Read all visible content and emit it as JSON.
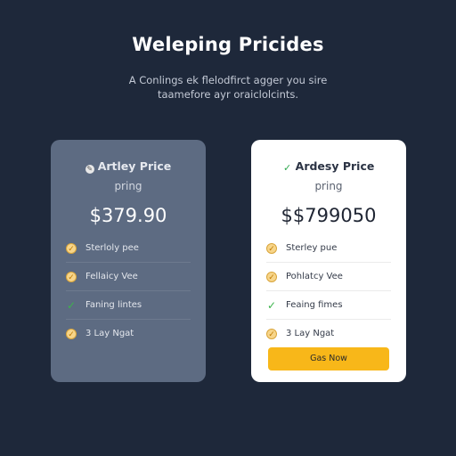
{
  "header": {
    "title": "Weleping Pricides",
    "subtitle_line1": "A  Conlings ek flelodfirct agger you sire",
    "subtitle_line2": "taamefore ayr oraiclolcints."
  },
  "plans": [
    {
      "name": "Artley Price",
      "badge_icon": "badge-icon",
      "subtitle": "pring",
      "price": "$379.90",
      "features": [
        {
          "label": "Sterloly pee",
          "check": "gold"
        },
        {
          "label": "Fellaicy Vee",
          "check": "gold"
        },
        {
          "label": "Faning lintes",
          "check": "green"
        },
        {
          "label": "3 Lay Ngat",
          "check": "gold"
        }
      ]
    },
    {
      "name": "Ardesy Price",
      "badge_icon": "check-icon",
      "subtitle": "pring",
      "price": "$$799050",
      "features": [
        {
          "label": "Sterley pue",
          "check": "gold"
        },
        {
          "label": "Pohlatcy Vee",
          "check": "gold"
        },
        {
          "label": "Feaing fimes",
          "check": "green"
        },
        {
          "label": "3 Lay Ngat",
          "check": "gold"
        }
      ],
      "cta_label": "Gas Now"
    }
  ],
  "colors": {
    "background": "#1e283a",
    "card_left": "#5d6b82",
    "card_right": "#ffffff",
    "cta": "#f8b719"
  }
}
